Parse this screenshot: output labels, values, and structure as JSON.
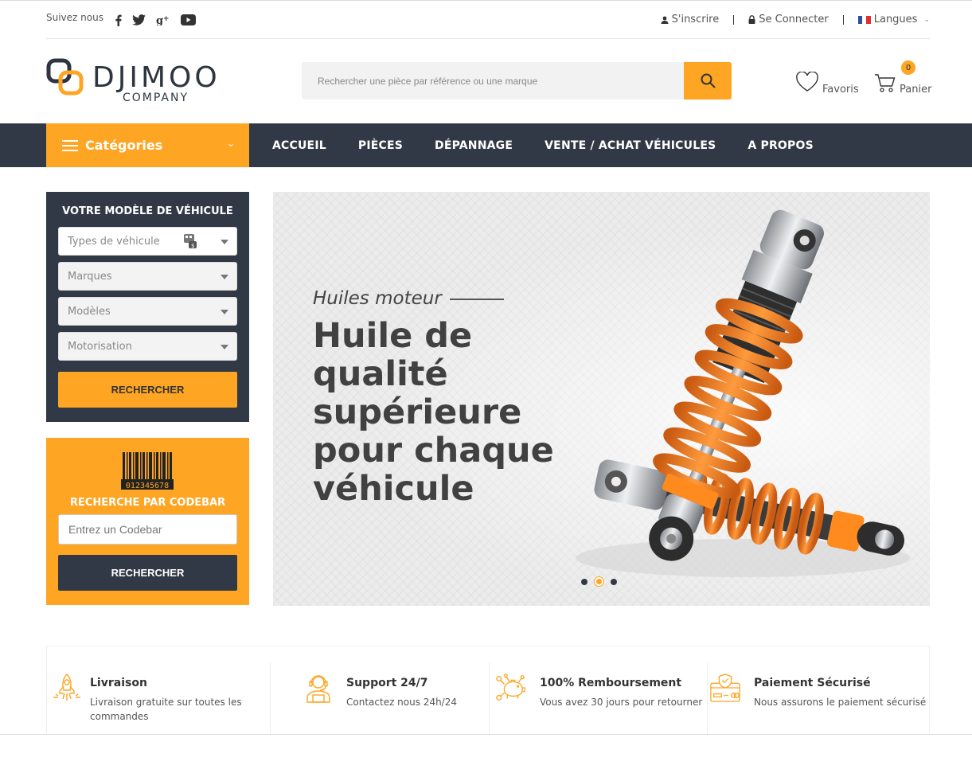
{
  "topbar": {
    "follow_label": "Suivez nous",
    "social": [
      "facebook-icon",
      "twitter-icon",
      "google-plus-icon",
      "youtube-icon"
    ],
    "signup": "S'inscrire",
    "login": "Se Connecter",
    "language": "Langues"
  },
  "header": {
    "logo_text": "DJIMOO",
    "logo_sub": "COMPANY",
    "search_placeholder": "Rechercher une pièce par référence ou une marque",
    "favorites_label": "Favoris",
    "cart_label": "Panier",
    "cart_count": "0"
  },
  "nav": {
    "categories_label": "Catégories",
    "items": [
      "ACCUEIL",
      "PIÈCES",
      "DÉPANNAGE",
      "VENTE / ACHAT VÉHICULES",
      "A PROPOS"
    ]
  },
  "vehicle_search": {
    "title": "VOTRE MODÈLE DE VÉHICULE",
    "type_placeholder": "Types de véhicule",
    "brand_placeholder": "Marques",
    "model_placeholder": "Modèles",
    "engine_placeholder": "Motorisation",
    "button": "RECHERCHER"
  },
  "codebar_search": {
    "barcode_digits": "012345678",
    "title": "RECHERCHE PAR CODEBAR",
    "input_placeholder": "Entrez un Codebar",
    "button": "RECHERCHER"
  },
  "hero": {
    "subtitle": "Huiles moteur",
    "title": "Huile de qualité supérieure pour chaque véhicule",
    "slide_count": 3,
    "active_slide": 2
  },
  "features": [
    {
      "icon": "rocket-icon",
      "title": "Livraison",
      "desc": "Livraison gratuite sur toutes les commandes"
    },
    {
      "icon": "support-agent-icon",
      "title": "Support 24/7",
      "desc": "Contactez nous 24h/24"
    },
    {
      "icon": "piggy-bank-icon",
      "title": "100% Remboursement",
      "desc": "Vous avez 30 jours pour retourner"
    },
    {
      "icon": "secure-payment-icon",
      "title": "Paiement Sécurisé",
      "desc": "Nous assurons le paiement sécurisé"
    }
  ],
  "colors": {
    "accent": "#fea523",
    "dark": "#323946"
  }
}
